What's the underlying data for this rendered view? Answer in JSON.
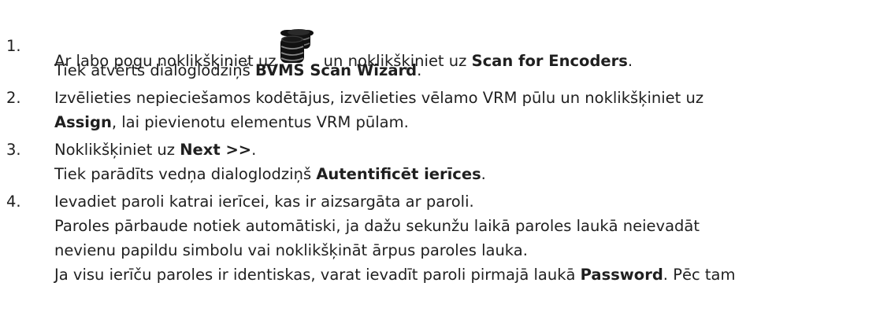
{
  "steps": [
    {
      "number": "1.",
      "line1_before_icon": "Ar labo pogu noklikšķiniet uz",
      "line1_after_icon": " un noklikšķiniet uz ",
      "line1_bold": "Scan for Encoders",
      "line1_end": ".",
      "line2_pre": "Tiek atvērts dialoglodziņš ",
      "line2_bold": "BVMS Scan Wizard",
      "line2_end": ".",
      "icon": "database-icon"
    },
    {
      "number": "2.",
      "line1": "Izvēlieties nepieciešamos kodētājus, izvēlieties vēlamo VRM pūlu un noklikšķiniet uz",
      "line2_bold": "Assign",
      "line2_rest": ", lai pievienotu elementus VRM pūlam."
    },
    {
      "number": "3.",
      "line1_pre": "Noklikšķiniet uz ",
      "line1_bold": "Next >>",
      "line1_end": ".",
      "line2_pre": "Tiek parādīts vedņa dialoglodziņš ",
      "line2_bold": "Autentificēt ierīces",
      "line2_end": "."
    },
    {
      "number": "4.",
      "line1": "Ievadiet paroli katrai ierīcei, kas ir aizsargāta ar paroli.",
      "line2": "Paroles pārbaude notiek automātiski, ja dažu sekunžu laikā paroles laukā neievadāt",
      "line3": "nevienu papildu simbolu vai noklikšķināt ārpus paroles lauka.",
      "line4_pre": "Ja visu ierīču paroles ir identiskas, varat ievadīt paroli pirmajā laukā ",
      "line4_bold": "Password",
      "line4_end": ". Pēc tam"
    }
  ]
}
